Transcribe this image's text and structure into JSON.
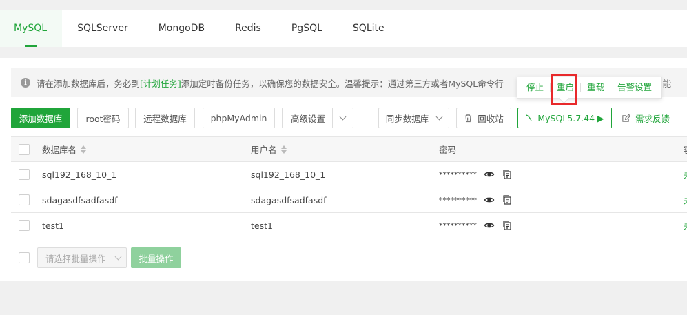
{
  "tabs": [
    "MySQL",
    "SQLServer",
    "MongoDB",
    "Redis",
    "PgSQL",
    "SQLite"
  ],
  "notice": {
    "text_before": "请在添加数据库后，务必到",
    "link": "[计划任务]",
    "text_after": "添加定时备份任务，以确保您的数据安全。温馨提示：通过第三方或者MySQL命令行",
    "text_tail": "取\"才能"
  },
  "popover": {
    "stop": "停止",
    "restart": "重启",
    "reload": "重载",
    "alert": "告警设置"
  },
  "toolbar": {
    "add_db": "添加数据库",
    "root_pwd": "root密码",
    "remote_db": "远程数据库",
    "phpmyadmin": "phpMyAdmin",
    "advanced": "高级设置",
    "sync_db": "同步数据库",
    "recycle": "回收站",
    "mysql_version": "MySQL5.7.44 ▶",
    "feedback": "需求反馈"
  },
  "table": {
    "headers": {
      "db_name": "数据库名",
      "user_name": "用户名",
      "password": "密码",
      "extra": "容"
    },
    "rows": [
      {
        "db": "sql192_168_10_1",
        "user": "sql192_168_10_1",
        "pwd": "**********",
        "extra": "未"
      },
      {
        "db": "sdagasdfsadfasdf",
        "user": "sdagasdfsadfasdf",
        "pwd": "**********",
        "extra": "未"
      },
      {
        "db": "test1",
        "user": "test1",
        "pwd": "**********",
        "extra": "未"
      }
    ]
  },
  "footer": {
    "batch_placeholder": "请选择批量操作",
    "batch_button": "批量操作"
  },
  "colors": {
    "accent": "#20a53a",
    "highlight": "#e8292b"
  },
  "icons": [
    "info-icon",
    "trash-icon",
    "eye-icon",
    "copy-icon",
    "edit-icon",
    "chevron-down-icon",
    "sort-icon"
  ]
}
